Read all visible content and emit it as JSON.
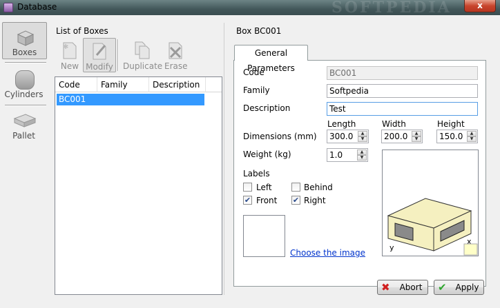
{
  "window": {
    "title": "Database",
    "close_label": "x",
    "watermark": "SOFTPEDIA"
  },
  "nav": {
    "items": [
      {
        "label": "Boxes",
        "icon": "box-icon",
        "active": true
      },
      {
        "label": "Cylinders",
        "icon": "cylinder-icon",
        "active": false
      },
      {
        "label": "Pallet",
        "icon": "pallet-icon",
        "active": false
      }
    ]
  },
  "list": {
    "title": "List of Boxes",
    "toolbar": {
      "new_label": "New",
      "modify_label": "Modify",
      "duplicate_label": "Duplicate",
      "erase_label": "Erase"
    },
    "columns": [
      "Code",
      "Family",
      "Description"
    ],
    "rows": [
      {
        "code": "BC001",
        "family": "",
        "description": ""
      }
    ]
  },
  "detail": {
    "title": "Box BC001",
    "tab_label": "General Parameters",
    "code_label": "Code",
    "code_value": "BC001",
    "family_label": "Family",
    "family_value": "Softpedia",
    "description_label": "Description",
    "description_value": "Test",
    "dimensions_label": "Dimensions (mm)",
    "length_label": "Length",
    "length_value": "300.0",
    "width_label": "Width",
    "width_value": "200.0",
    "height_label": "Height",
    "height_value": "150.0",
    "weight_label": "Weight (kg)",
    "weight_value": "1.0",
    "labels_title": "Labels",
    "left_label": "Left",
    "left_checked": false,
    "behind_label": "Behind",
    "behind_checked": false,
    "front_label": "Front",
    "front_checked": true,
    "right_label": "Right",
    "right_checked": true,
    "choose_image_link": "Choose the image",
    "axis_y": "y",
    "axis_x": "x"
  },
  "buttons": {
    "abort_label": "Abort",
    "apply_label": "Apply"
  },
  "colors": {
    "selection": "#3399ff",
    "box_face": "#f5f0c0",
    "close_red": "#c8452d",
    "apply_check": "#2fa52f",
    "abort_cross": "#d02020"
  }
}
